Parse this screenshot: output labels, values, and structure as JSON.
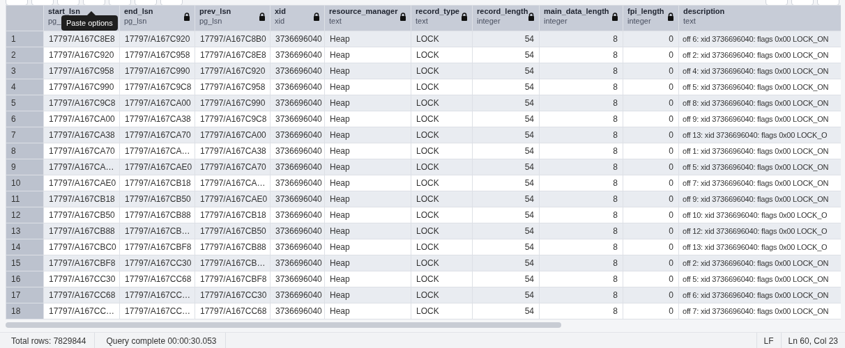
{
  "tooltip": {
    "text": "Paste options"
  },
  "table": {
    "columns": [
      {
        "name": "start_lsn",
        "type": "pg_",
        "locked": false,
        "kind": "text"
      },
      {
        "name": "end_lsn",
        "type": "pg_lsn",
        "locked": true,
        "kind": "text"
      },
      {
        "name": "prev_lsn",
        "type": "pg_lsn",
        "locked": true,
        "kind": "text"
      },
      {
        "name": "xid",
        "type": "xid",
        "locked": true,
        "kind": "text"
      },
      {
        "name": "resource_manager",
        "type": "text",
        "locked": true,
        "kind": "text"
      },
      {
        "name": "record_type",
        "type": "text",
        "locked": true,
        "kind": "text"
      },
      {
        "name": "record_length",
        "type": "integer",
        "locked": true,
        "kind": "number"
      },
      {
        "name": "main_data_length",
        "type": "integer",
        "locked": true,
        "kind": "number"
      },
      {
        "name": "fpi_length",
        "type": "integer",
        "locked": true,
        "kind": "number"
      },
      {
        "name": "description",
        "type": "text",
        "locked": false,
        "kind": "text"
      }
    ],
    "rows": [
      {
        "number": "1",
        "cells": [
          "17797/A167C8E8",
          "17797/A167C920",
          "17797/A167C8B0",
          "3736696040",
          "Heap",
          "LOCK",
          "54",
          "8",
          "0",
          "off 6: xid 3736696040: flags 0x00 LOCK_ON"
        ]
      },
      {
        "number": "2",
        "cells": [
          "17797/A167C920",
          "17797/A167C958",
          "17797/A167C8E8",
          "3736696040",
          "Heap",
          "LOCK",
          "54",
          "8",
          "0",
          "off 2: xid 3736696040: flags 0x00 LOCK_ON"
        ]
      },
      {
        "number": "3",
        "cells": [
          "17797/A167C958",
          "17797/A167C990",
          "17797/A167C920",
          "3736696040",
          "Heap",
          "LOCK",
          "54",
          "8",
          "0",
          "off 4: xid 3736696040: flags 0x00 LOCK_ON"
        ]
      },
      {
        "number": "4",
        "cells": [
          "17797/A167C990",
          "17797/A167C9C8",
          "17797/A167C958",
          "3736696040",
          "Heap",
          "LOCK",
          "54",
          "8",
          "0",
          "off 5: xid 3736696040: flags 0x00 LOCK_ON"
        ]
      },
      {
        "number": "5",
        "cells": [
          "17797/A167C9C8",
          "17797/A167CA00",
          "17797/A167C990",
          "3736696040",
          "Heap",
          "LOCK",
          "54",
          "8",
          "0",
          "off 8: xid 3736696040: flags 0x00 LOCK_ON"
        ]
      },
      {
        "number": "6",
        "cells": [
          "17797/A167CA00",
          "17797/A167CA38",
          "17797/A167C9C8",
          "3736696040",
          "Heap",
          "LOCK",
          "54",
          "8",
          "0",
          "off 9: xid 3736696040: flags 0x00 LOCK_ON"
        ]
      },
      {
        "number": "7",
        "cells": [
          "17797/A167CA38",
          "17797/A167CA70",
          "17797/A167CA00",
          "3736696040",
          "Heap",
          "LOCK",
          "54",
          "8",
          "0",
          "off 13: xid 3736696040: flags 0x00 LOCK_O"
        ]
      },
      {
        "number": "8",
        "cells": [
          "17797/A167CA70",
          "17797/A167CA…",
          "17797/A167CA38",
          "3736696040",
          "Heap",
          "LOCK",
          "54",
          "8",
          "0",
          "off 1: xid 3736696040: flags 0x00 LOCK_ON"
        ]
      },
      {
        "number": "9",
        "cells": [
          "17797/A167CA…",
          "17797/A167CAE0",
          "17797/A167CA70",
          "3736696040",
          "Heap",
          "LOCK",
          "54",
          "8",
          "0",
          "off 5: xid 3736696040: flags 0x00 LOCK_ON"
        ]
      },
      {
        "number": "10",
        "cells": [
          "17797/A167CAE0",
          "17797/A167CB18",
          "17797/A167CA…",
          "3736696040",
          "Heap",
          "LOCK",
          "54",
          "8",
          "0",
          "off 7: xid 3736696040: flags 0x00 LOCK_ON"
        ]
      },
      {
        "number": "11",
        "cells": [
          "17797/A167CB18",
          "17797/A167CB50",
          "17797/A167CAE0",
          "3736696040",
          "Heap",
          "LOCK",
          "54",
          "8",
          "0",
          "off 9: xid 3736696040: flags 0x00 LOCK_ON"
        ]
      },
      {
        "number": "12",
        "cells": [
          "17797/A167CB50",
          "17797/A167CB88",
          "17797/A167CB18",
          "3736696040",
          "Heap",
          "LOCK",
          "54",
          "8",
          "0",
          "off 10: xid 3736696040: flags 0x00 LOCK_O"
        ]
      },
      {
        "number": "13",
        "cells": [
          "17797/A167CB88",
          "17797/A167CB…",
          "17797/A167CB50",
          "3736696040",
          "Heap",
          "LOCK",
          "54",
          "8",
          "0",
          "off 12: xid 3736696040: flags 0x00 LOCK_O"
        ]
      },
      {
        "number": "14",
        "cells": [
          "17797/A167CBC0",
          "17797/A167CBF8",
          "17797/A167CB88",
          "3736696040",
          "Heap",
          "LOCK",
          "54",
          "8",
          "0",
          "off 13: xid 3736696040: flags 0x00 LOCK_O"
        ]
      },
      {
        "number": "15",
        "cells": [
          "17797/A167CBF8",
          "17797/A167CC30",
          "17797/A167CB…",
          "3736696040",
          "Heap",
          "LOCK",
          "54",
          "8",
          "0",
          "off 2: xid 3736696040: flags 0x00 LOCK_ON"
        ]
      },
      {
        "number": "16",
        "cells": [
          "17797/A167CC30",
          "17797/A167CC68",
          "17797/A167CBF8",
          "3736696040",
          "Heap",
          "LOCK",
          "54",
          "8",
          "0",
          "off 5: xid 3736696040: flags 0x00 LOCK_ON"
        ]
      },
      {
        "number": "17",
        "cells": [
          "17797/A167CC68",
          "17797/A167CC…",
          "17797/A167CC30",
          "3736696040",
          "Heap",
          "LOCK",
          "54",
          "8",
          "0",
          "off 6: xid 3736696040: flags 0x00 LOCK_ON"
        ]
      },
      {
        "number": "18",
        "cells": [
          "17797/A167CC…",
          "17797/A167CC…",
          "17797/A167CC68",
          "3736696040",
          "Heap",
          "LOCK",
          "54",
          "8",
          "0",
          "off 7: xid 3736696040: flags 0x00 LOCK_ON"
        ]
      }
    ]
  },
  "status_bar": {
    "left": [
      "Total rows: 7829844",
      "Query complete 00:00:30.053"
    ],
    "right": [
      "LF",
      "Ln 60, Col 23"
    ]
  }
}
